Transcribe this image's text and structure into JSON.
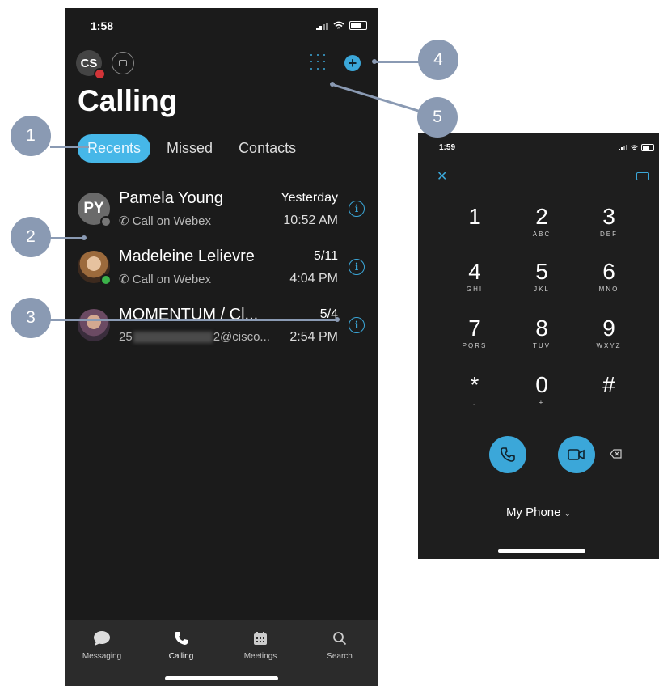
{
  "phone_main": {
    "status_time": "1:58",
    "avatar_initials": "CS",
    "title": "Calling",
    "tabs": [
      "Recents",
      "Missed",
      "Contacts"
    ],
    "active_tab": "Recents",
    "calls": [
      {
        "avatar": "PY",
        "name": "Pamela Young",
        "sub": "Call on Webex",
        "date": "Yesterday",
        "time": "10:52 AM"
      },
      {
        "avatar": "",
        "name": "Madeleine Lelievre",
        "sub": "Call on Webex",
        "date": "5/11",
        "time": "4:04 PM"
      },
      {
        "avatar": "",
        "name": "MOMENTUM / Cl...",
        "sub_prefix": "25",
        "sub_suffix": "2@cisco...",
        "date": "5/4",
        "time": "2:54 PM"
      }
    ],
    "bottom_tabs": [
      "Messaging",
      "Calling",
      "Meetings",
      "Search"
    ],
    "active_bottom_tab": "Calling"
  },
  "phone_dialer": {
    "status_time": "1:59",
    "keys": [
      {
        "digit": "1",
        "letters": ""
      },
      {
        "digit": "2",
        "letters": "ABC"
      },
      {
        "digit": "3",
        "letters": "DEF"
      },
      {
        "digit": "4",
        "letters": "GHI"
      },
      {
        "digit": "5",
        "letters": "JKL"
      },
      {
        "digit": "6",
        "letters": "MNO"
      },
      {
        "digit": "7",
        "letters": "PQRS"
      },
      {
        "digit": "8",
        "letters": "TUV"
      },
      {
        "digit": "9",
        "letters": "WXYZ"
      },
      {
        "digit": "*",
        "letters": ","
      },
      {
        "digit": "0",
        "letters": "+"
      },
      {
        "digit": "#",
        "letters": ""
      }
    ],
    "line_selector": "My Phone"
  },
  "callouts": [
    "1",
    "2",
    "3",
    "4",
    "5"
  ],
  "colors": {
    "accent": "#3ba7d9",
    "callout": "#8a9ab3",
    "background": "#1b1b1b"
  }
}
